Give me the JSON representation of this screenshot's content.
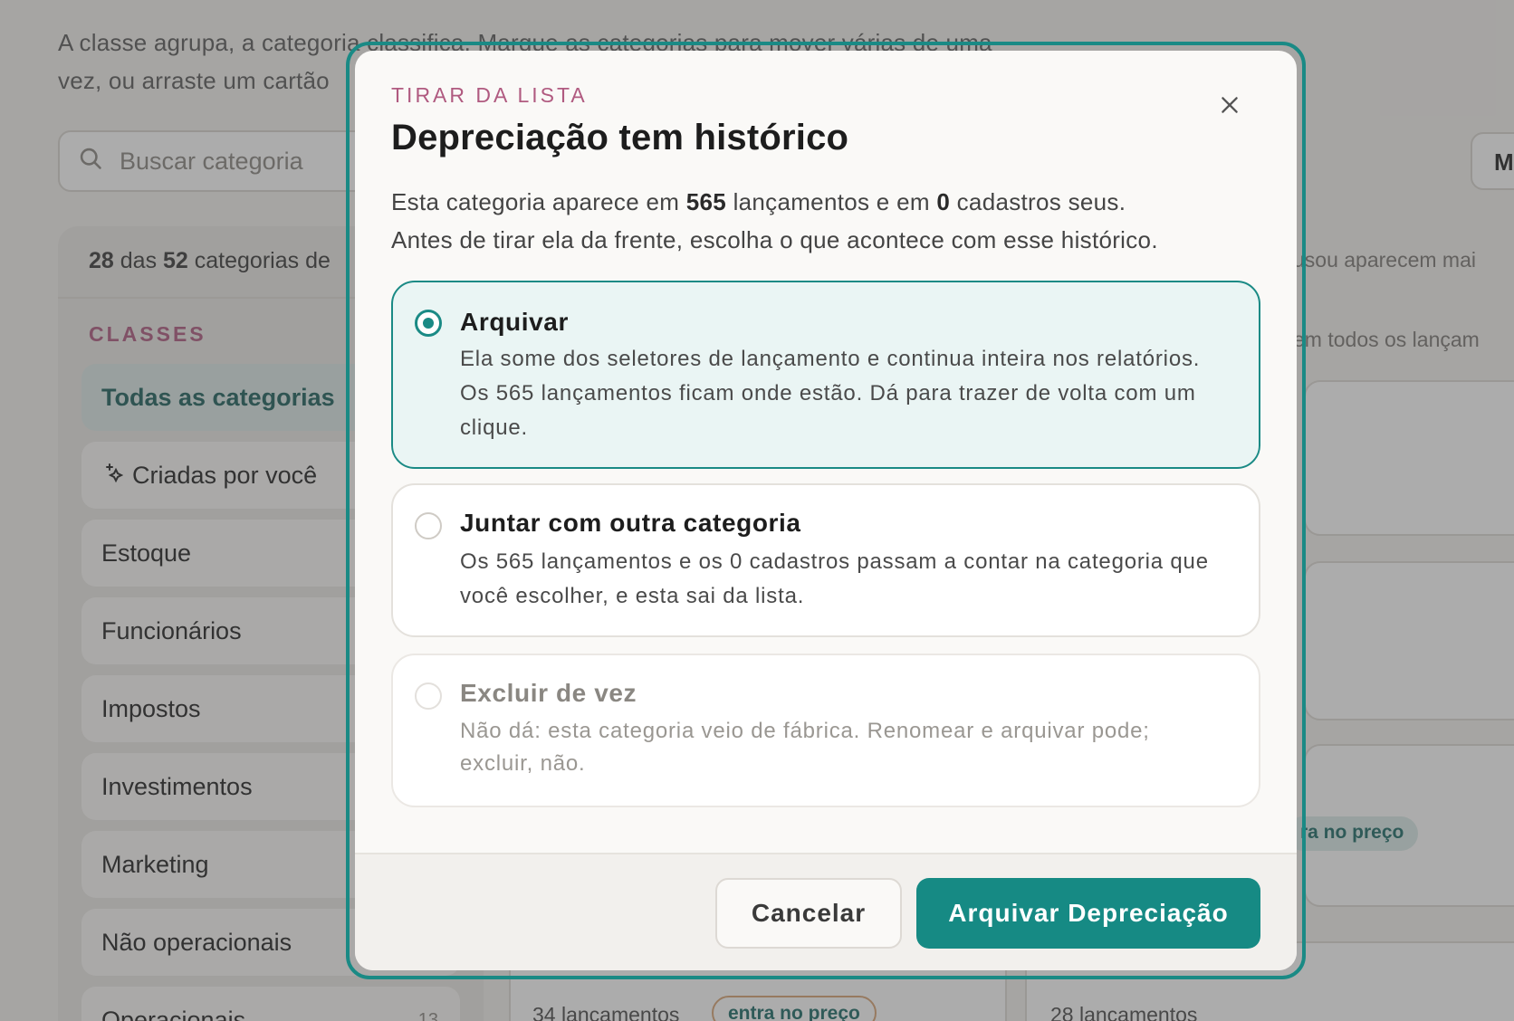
{
  "background": {
    "intro_line1": "A classe agrupa, a categoria classifica. Marque as categorias para mover várias de uma",
    "intro_line2": "vez, ou arraste um cartão",
    "search_placeholder": "Buscar categoria",
    "right_button_label": "M",
    "count_prefix": "28",
    "count_mid": " das ",
    "count_total": "52",
    "count_suffix": " categorias de",
    "classes_label": "CLASSES",
    "sidebar_items": [
      {
        "label": "Todas as categorias",
        "count": ""
      },
      {
        "label": "Criadas por você",
        "count": ""
      },
      {
        "label": "Estoque",
        "count": ""
      },
      {
        "label": "Funcionários",
        "count": ""
      },
      {
        "label": "Impostos",
        "count": ""
      },
      {
        "label": "Investimentos",
        "count": ""
      },
      {
        "label": "Marketing",
        "count": ""
      },
      {
        "label": "Não operacionais",
        "count": ""
      },
      {
        "label": "Operacionais",
        "count": "13"
      }
    ],
    "hint_right": "usou aparecem mai",
    "hint_right2": "em todos os lançam",
    "card_fragment": "a",
    "chip_price": "ra no preço",
    "card_a_foot": "34 lançamentos",
    "card_a_chip": "entra no preço",
    "card_b_foot": "28 lançamentos"
  },
  "modal": {
    "eyebrow": "TIRAR DA LISTA",
    "title": "Depreciação tem histórico",
    "desc_a": "Esta categoria aparece em ",
    "desc_n1": "565",
    "desc_b": " lançamentos e em ",
    "desc_n2": "0",
    "desc_c": " cadastros seus.",
    "desc_line2": "Antes de tirar ela da frente, escolha o que acontece com esse histórico.",
    "options": [
      {
        "title": "Arquivar",
        "body": "Ela some dos seletores de lançamento e continua inteira nos relatórios. Os 565 lançamentos ficam onde estão. Dá para trazer de volta com um clique.",
        "selected": true
      },
      {
        "title": "Juntar com outra categoria",
        "body": "Os 565 lançamentos e os 0 cadastros passam a contar na categoria que você escolher, e esta sai da lista.",
        "selected": false
      },
      {
        "title": "Excluir de vez",
        "body": "Não dá: esta categoria veio de fábrica. Renomear e arquivar pode; excluir, não.",
        "selected": false,
        "disabled": true
      }
    ],
    "cancel_label": "Cancelar",
    "confirm_label": "Arquivar Depreciação"
  },
  "colors": {
    "accent": "#168a84",
    "eyebrow": "#b05a80",
    "selected_bg": "#eaf5f4"
  },
  "icons": {
    "search": "search-icon",
    "close": "close-icon",
    "sparkle": "sparkle-icon"
  }
}
